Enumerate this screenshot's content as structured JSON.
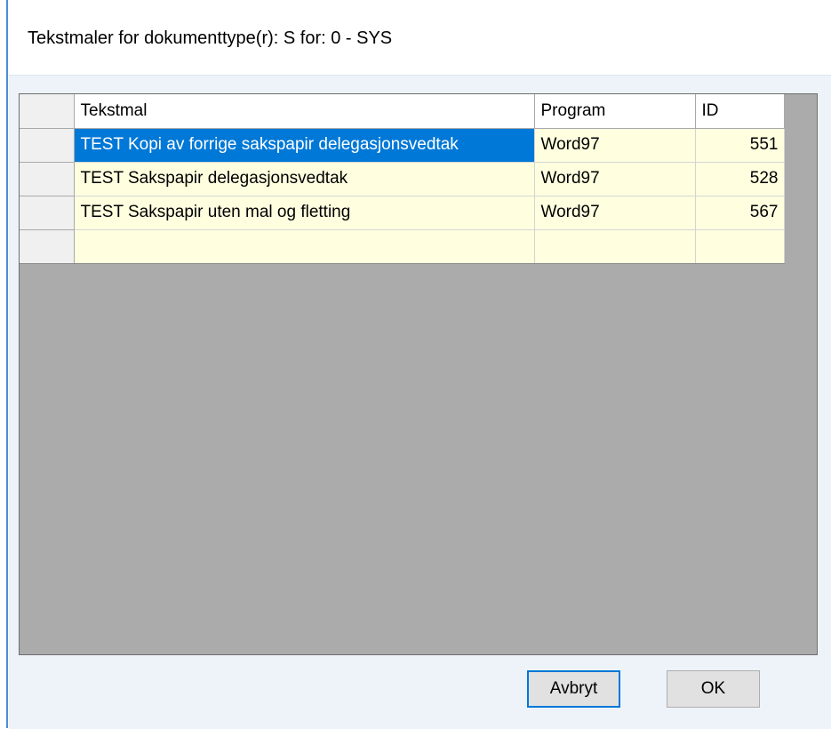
{
  "dialog": {
    "title": "Tekstmaler for dokumenttype(r): S for: 0 - SYS"
  },
  "grid": {
    "columns": [
      "Tekstmal",
      "Program",
      "ID"
    ],
    "rows": [
      {
        "tekstmal": "TEST Kopi av forrige sakspapir delegasjonsvedtak",
        "program": "Word97",
        "id": "551",
        "selected": true
      },
      {
        "tekstmal": "TEST Sakspapir delegasjonsvedtak",
        "program": "Word97",
        "id": "528",
        "selected": false
      },
      {
        "tekstmal": "TEST Sakspapir uten mal og fletting",
        "program": "Word97",
        "id": "567",
        "selected": false
      },
      {
        "tekstmal": "",
        "program": "",
        "id": "",
        "selected": false
      }
    ],
    "colors": {
      "selection": "#0078d7",
      "cell_background": "#ffffe0",
      "empty_area": "#ababab"
    }
  },
  "buttons": {
    "cancel_label": "Avbryt",
    "ok_label": "OK"
  }
}
